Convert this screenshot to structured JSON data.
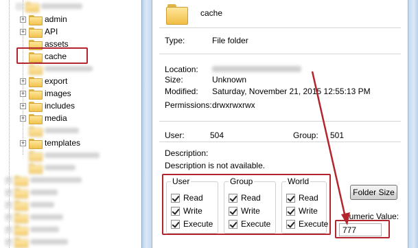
{
  "tree": {
    "items": [
      {
        "label": "",
        "blurred": true
      },
      {
        "label": "admin",
        "blurred": false,
        "expandable": true
      },
      {
        "label": "API",
        "blurred": false,
        "expandable": true
      },
      {
        "label": "assets",
        "blurred": false,
        "expandable": false
      },
      {
        "label": "cache",
        "blurred": false,
        "expandable": false,
        "highlighted": true
      },
      {
        "label": "",
        "blurred": true
      },
      {
        "label": "export",
        "blurred": false,
        "expandable": true
      },
      {
        "label": "images",
        "blurred": false,
        "expandable": true
      },
      {
        "label": "includes",
        "blurred": false,
        "expandable": true
      },
      {
        "label": "media",
        "blurred": false,
        "expandable": true
      },
      {
        "label": "",
        "blurred": true
      },
      {
        "label": "templates",
        "blurred": false,
        "expandable": true
      },
      {
        "label": "",
        "blurred": true
      },
      {
        "label": "",
        "blurred": true
      },
      {
        "label": "",
        "blurred": true
      },
      {
        "label": "",
        "blurred": true
      },
      {
        "label": "",
        "blurred": true
      },
      {
        "label": "",
        "blurred": true
      },
      {
        "label": "",
        "blurred": true
      }
    ]
  },
  "properties": {
    "folder_name": "cache",
    "type_label": "Type:",
    "type_value": "File folder",
    "location_label": "Location:",
    "location_value": "",
    "size_label": "Size:",
    "size_value": "Unknown",
    "modified_label": "Modified:",
    "modified_value": "Saturday, November 21, 2015 12:55:13 PM",
    "permissions_label": "Permissions:",
    "permissions_value": "drwxrwxrwx",
    "user_label": "User:",
    "user_value": "504",
    "group_label": "Group:",
    "group_value": "501",
    "description_label": "Description:",
    "description_value": "Description is not available.",
    "perm_groups": [
      {
        "title": "User",
        "read": "Read",
        "write": "Write",
        "execute": "Execute"
      },
      {
        "title": "Group",
        "read": "Read",
        "write": "Write",
        "execute": "Execute"
      },
      {
        "title": "World",
        "read": "Read",
        "write": "Write",
        "execute": "Execute"
      }
    ],
    "folder_size_button": "Folder Size",
    "numeric_value_label": "Numeric Value:",
    "numeric_value": "777"
  },
  "colors": {
    "annotation": "#b3242c",
    "folder_icon": "#f2c24f"
  }
}
